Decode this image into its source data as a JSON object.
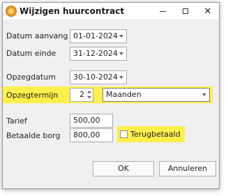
{
  "window": {
    "title": "Wijzigen huurcontract"
  },
  "fields": {
    "datum_aanvang": {
      "label": "Datum aanvang",
      "value": "01-01-2024"
    },
    "datum_einde": {
      "label": "Datum einde",
      "value": "31-12-2024"
    },
    "opzegdatum": {
      "label": "Opzegdatum",
      "value": "30-10-2024"
    },
    "opzegtermijn": {
      "label": "Opzegtermijn",
      "value": "2",
      "unit": "Maanden"
    },
    "tarief": {
      "label": "Tarief",
      "value": "500,00"
    },
    "betaalde_borg": {
      "label": "Betaalde borg",
      "value": "800,00"
    },
    "terugbetaald": {
      "label": "Terugbetaald",
      "checked": false
    }
  },
  "buttons": {
    "ok": "OK",
    "cancel": "Annuleren"
  },
  "colors": {
    "highlight": "#ffef4a"
  }
}
